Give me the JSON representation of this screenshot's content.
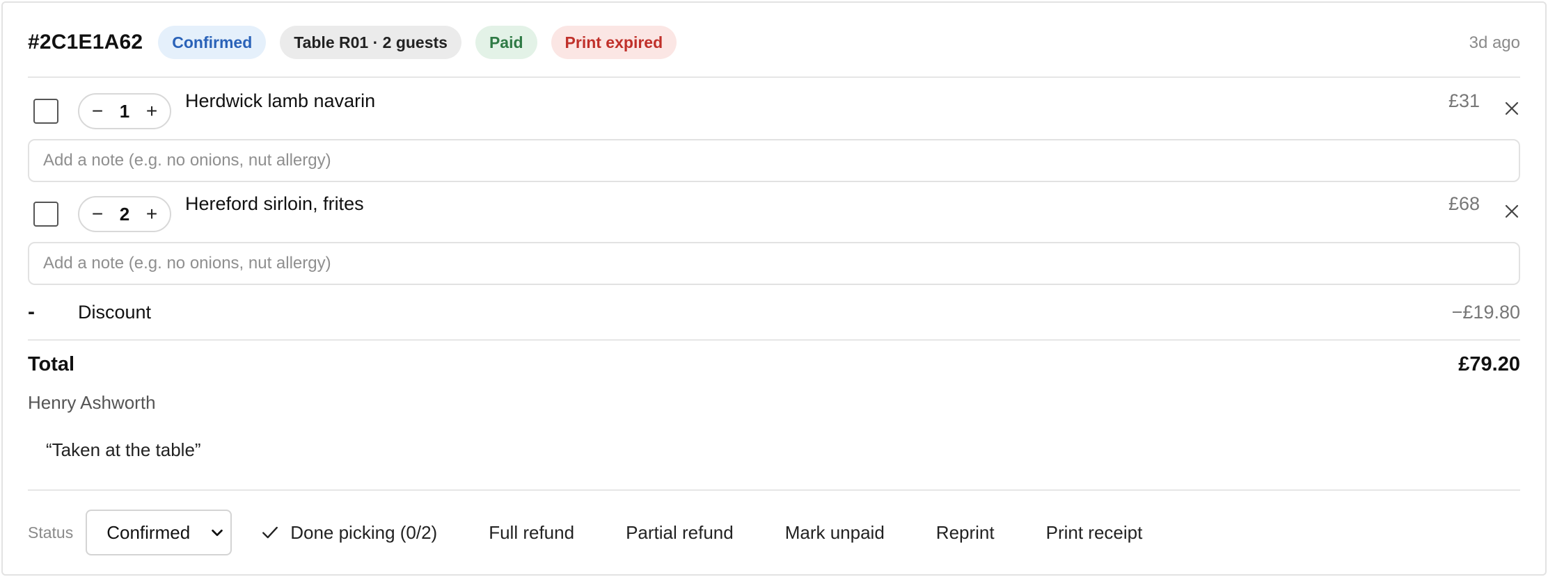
{
  "order": {
    "id": "#2C1E1A62",
    "badges": {
      "status": "Confirmed",
      "table": "Table R01 · 2 guests",
      "payment": "Paid",
      "print": "Print expired"
    },
    "time_ago": "3d ago"
  },
  "items": [
    {
      "name": "Herdwick lamb navarin",
      "quantity": "1",
      "price": "£31",
      "note_value": "",
      "note_placeholder": "Add a note (e.g. no onions, nut allergy)"
    },
    {
      "name": "Hereford sirloin, frites",
      "quantity": "2",
      "price": "£68",
      "note_value": "",
      "note_placeholder": "Add a note (e.g. no onions, nut allergy)"
    }
  ],
  "stepper": {
    "minus": "−",
    "plus": "+"
  },
  "discount": {
    "sign": "-",
    "label": "Discount",
    "amount": "−£19.80"
  },
  "total": {
    "label": "Total",
    "amount": "£79.20"
  },
  "customer_name": "Henry Ashworth",
  "order_note": "“Taken at the table”",
  "footer": {
    "status_label": "Status",
    "status_value": "Confirmed",
    "actions": {
      "done_picking": "Done picking (0/2)",
      "full_refund": "Full refund",
      "partial_refund": "Partial refund",
      "mark_unpaid": "Mark unpaid",
      "reprint": "Reprint",
      "print_receipt": "Print receipt"
    }
  },
  "colors": {
    "confirmed_badge": "#e5f0fb",
    "paid_badge": "#e3f2e7",
    "print_expired_badge": "#fbe6e4",
    "table_badge": "#ebebeb"
  },
  "icons": [
    "close-icon",
    "check-icon",
    "chevron-down-icon"
  ]
}
